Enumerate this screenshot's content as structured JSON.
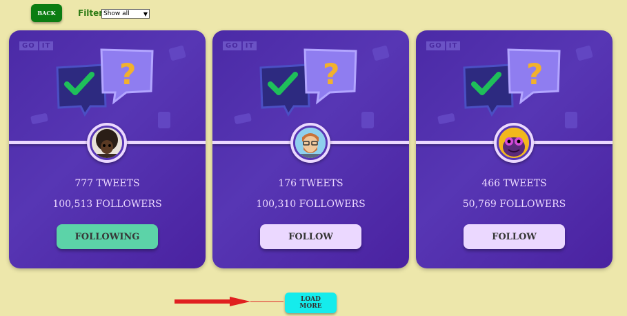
{
  "header": {
    "back_label": "BACK",
    "filter_label": "Filter",
    "filter_selected": "Show all"
  },
  "cards": [
    {
      "logo_left": "GO",
      "logo_right": "IT",
      "tweets": "777 TWEETS",
      "followers": "100,513 FOLLOWERS",
      "button_label": "FOLLOWING",
      "avatar": "afro-avatar-icon"
    },
    {
      "logo_left": "GO",
      "logo_right": "IT",
      "tweets": "176 TWEETS",
      "followers": "100,310 FOLLOWERS",
      "button_label": "FOLLOW",
      "avatar": "bearded-man-avatar-icon"
    },
    {
      "logo_left": "GO",
      "logo_right": "IT",
      "tweets": "466 TWEETS",
      "followers": "50,769 FOLLOWERS",
      "button_label": "FOLLOW",
      "avatar": "purple-creature-avatar-icon"
    }
  ],
  "footer": {
    "load_more_label": "LOAD MORE"
  },
  "colors": {
    "background": "#ede7ab",
    "card": "#5736b4",
    "following": "#5cd3a8",
    "follow": "#ebd8ff",
    "load_more": "#15ecec",
    "back": "#0b7d12",
    "annotation_arrow": "#e02020"
  }
}
